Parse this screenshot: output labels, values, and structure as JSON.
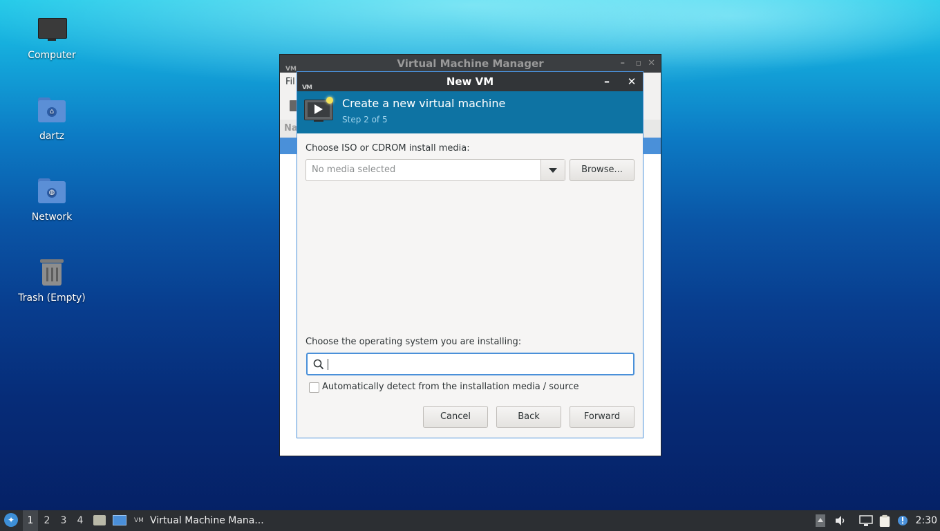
{
  "desktop": {
    "icons": [
      {
        "label": "Computer"
      },
      {
        "label": "dartz"
      },
      {
        "label": "Network"
      },
      {
        "label": "Trash (Empty)"
      }
    ]
  },
  "vmm_window": {
    "title": "Virtual Machine Manager",
    "menu_first": "Fil",
    "column_header": "Na"
  },
  "dialog": {
    "title": "New VM",
    "header_title": "Create a new virtual machine",
    "header_step": "Step 2 of 5",
    "media_label": "Choose ISO or CDROM install media:",
    "media_combo_placeholder": "No media selected",
    "browse_label": "Browse...",
    "os_label": "Choose the operating system you are installing:",
    "os_search_value": "",
    "auto_detect_label": "Automatically detect from the installation media / source",
    "auto_detect_checked": false,
    "cancel_label": "Cancel",
    "back_label": "Back",
    "forward_label": "Forward"
  },
  "taskbar": {
    "workspaces": [
      "1",
      "2",
      "3",
      "4"
    ],
    "active_workspace": "1",
    "task_label": "Virtual Machine Mana...",
    "clock": "2:30"
  },
  "icons": {
    "start": "lubuntu-start-icon",
    "volume": "speaker-icon",
    "network": "network-icon",
    "clipboard": "clipboard-icon",
    "notification": "notification-icon"
  },
  "colors": {
    "accent": "#4a90d9",
    "header_bg": "#0e73a3",
    "titlebar_bg": "#323538",
    "taskbar_bg": "#2c2f33"
  }
}
